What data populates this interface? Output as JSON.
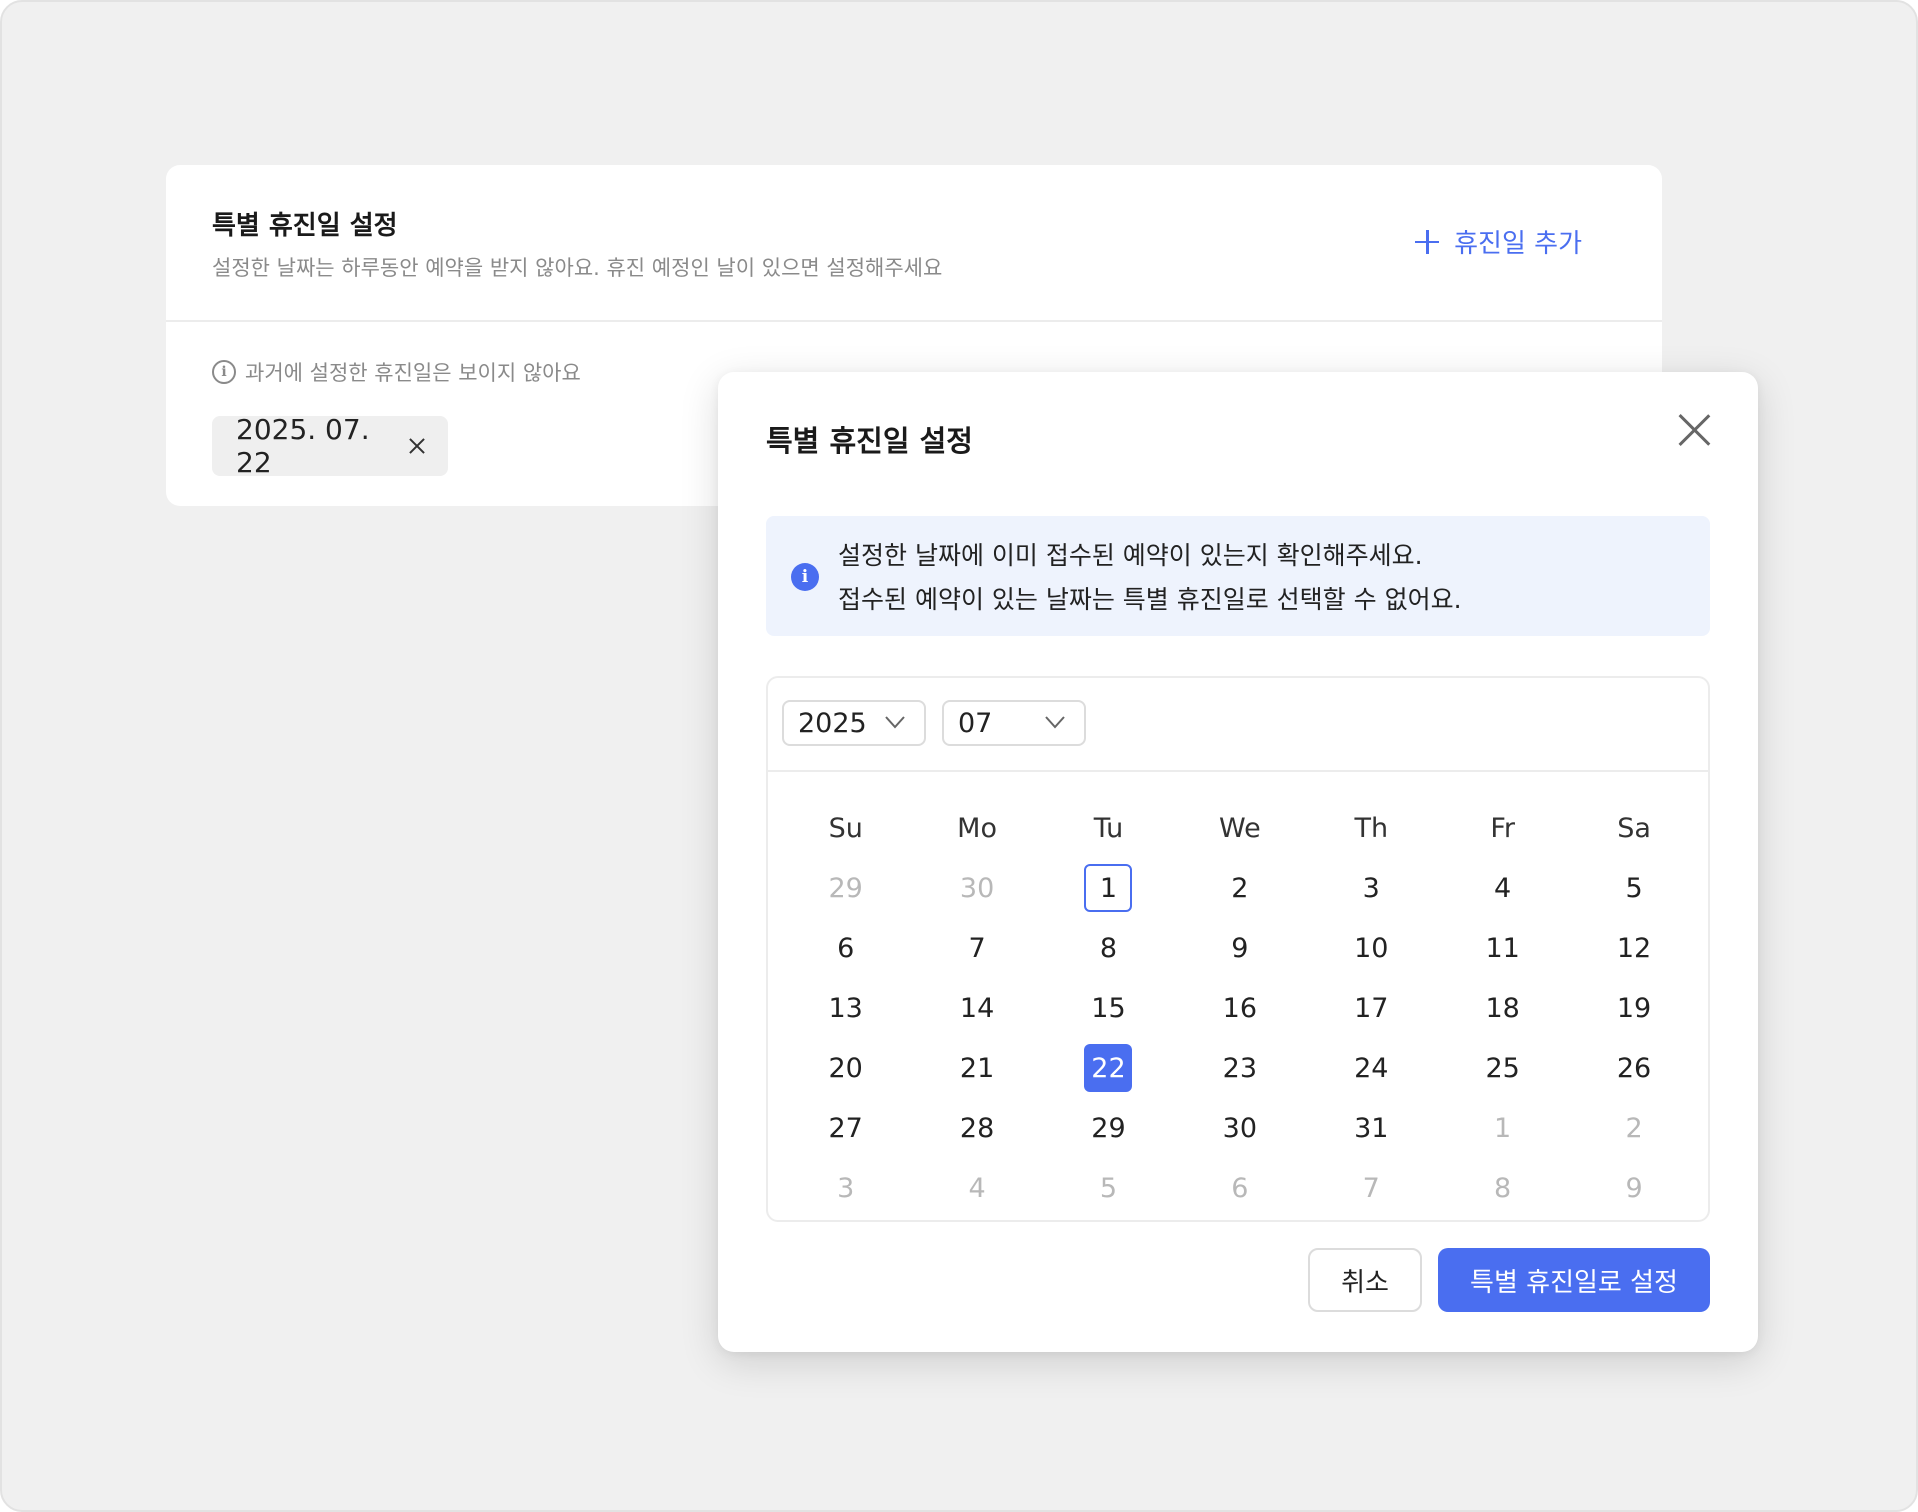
{
  "card": {
    "title": "특별 휴진일 설정",
    "description": "설정한 날짜는 하루동안 예약을 받지 않아요. 휴진 예정인 날이 있으면 설정해주세요",
    "add_label": "휴진일 추가",
    "past_note": "과거에 설정한 휴진일은 보이지 않아요",
    "chip_date": "2025. 07. 22"
  },
  "modal": {
    "title": "특별 휴진일 설정",
    "notice_line1": "설정한 날짜에 이미 접수된 예약이 있는지 확인해주세요.",
    "notice_line2": "접수된 예약이 있는 날짜는 특별 휴진일로 선택할 수 없어요.",
    "year": "2025",
    "month": "07",
    "cancel_label": "취소",
    "confirm_label": "특별 휴진일로 설정"
  },
  "calendar": {
    "weekdays": [
      "Su",
      "Mo",
      "Tu",
      "We",
      "Th",
      "Fr",
      "Sa"
    ],
    "weeks": [
      [
        {
          "d": "29",
          "m": true
        },
        {
          "d": "30",
          "m": true
        },
        {
          "d": "1",
          "today": true
        },
        {
          "d": "2"
        },
        {
          "d": "3"
        },
        {
          "d": "4"
        },
        {
          "d": "5"
        }
      ],
      [
        {
          "d": "6"
        },
        {
          "d": "7"
        },
        {
          "d": "8"
        },
        {
          "d": "9"
        },
        {
          "d": "10"
        },
        {
          "d": "11"
        },
        {
          "d": "12"
        }
      ],
      [
        {
          "d": "13"
        },
        {
          "d": "14"
        },
        {
          "d": "15"
        },
        {
          "d": "16"
        },
        {
          "d": "17"
        },
        {
          "d": "18"
        },
        {
          "d": "19"
        }
      ],
      [
        {
          "d": "20"
        },
        {
          "d": "21"
        },
        {
          "d": "22",
          "selected": true
        },
        {
          "d": "23"
        },
        {
          "d": "24"
        },
        {
          "d": "25"
        },
        {
          "d": "26"
        }
      ],
      [
        {
          "d": "27"
        },
        {
          "d": "28"
        },
        {
          "d": "29"
        },
        {
          "d": "30"
        },
        {
          "d": "31"
        },
        {
          "d": "1",
          "m": true
        },
        {
          "d": "2",
          "m": true
        }
      ],
      [
        {
          "d": "3",
          "m": true
        },
        {
          "d": "4",
          "m": true
        },
        {
          "d": "5",
          "m": true
        },
        {
          "d": "6",
          "m": true
        },
        {
          "d": "7",
          "m": true
        },
        {
          "d": "8",
          "m": true
        },
        {
          "d": "9",
          "m": true
        }
      ]
    ]
  },
  "colors": {
    "accent": "#4a6ef0",
    "muted": "#b8b8b8",
    "notice_bg": "#eef3fd"
  },
  "icons": [
    "plus-icon",
    "info-icon",
    "close-icon",
    "chevron-down-icon"
  ]
}
